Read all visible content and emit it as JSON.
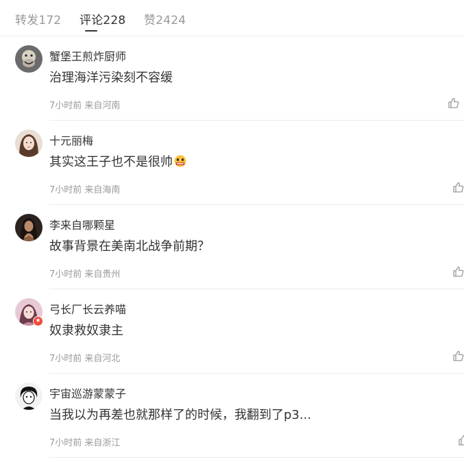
{
  "tabs": [
    {
      "label": "转发172",
      "active": false
    },
    {
      "label": "评论228",
      "active": true
    },
    {
      "label": "赞2424",
      "active": false
    }
  ],
  "comments": [
    {
      "username": "蟹堡王煎炸厨师",
      "text": "治理海洋污染刻不容缓",
      "time": "7小时前",
      "source": "来自河南",
      "avatar": "avatar-icon"
    },
    {
      "username": "十元丽梅",
      "text": "其实这王子也不是很帅",
      "emoji": "emoji-icon",
      "time": "7小时前",
      "source": "来自海南",
      "avatar": "avatar-icon"
    },
    {
      "username": "李来自哪颗星",
      "text": "故事背景在美南北战争前期？",
      "time": "7小时前",
      "source": "来自贵州",
      "avatar": "avatar-icon"
    },
    {
      "username": "弓长厂长云养喵",
      "text": "奴隶救奴隶主",
      "time": "7小时前",
      "source": "来自河北",
      "avatar": "avatar-icon",
      "badge": "vip-badge-icon"
    },
    {
      "username": "宇宙巡游蒙蒙子",
      "text": "当我以为再差也就那样了的时候，我翻到了p3...",
      "time": "7小时前",
      "source": "来自浙江",
      "avatar": "avatar-icon"
    }
  ],
  "icons": {
    "like": "thumbs-up-icon"
  },
  "colors": {
    "text": "#333333",
    "muted": "#999999",
    "divider": "#ececec",
    "badge": "#f04a3a"
  }
}
